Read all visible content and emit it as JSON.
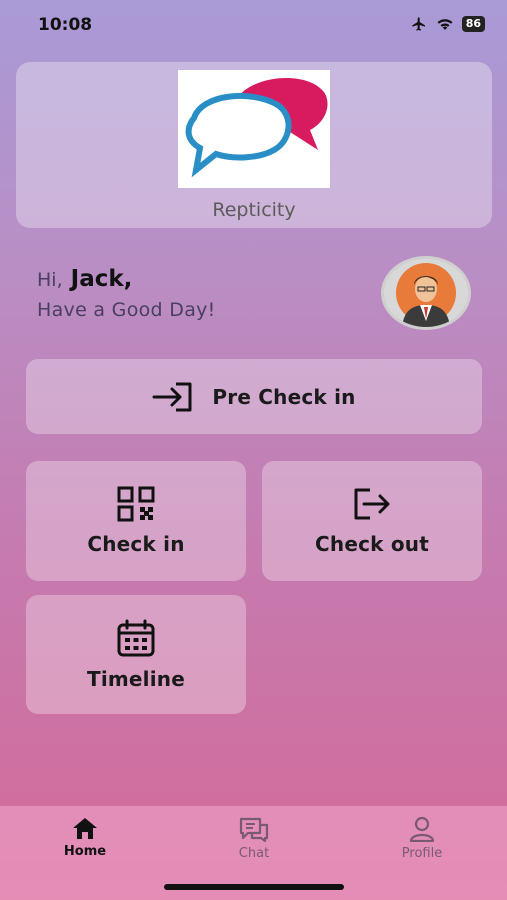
{
  "status_bar": {
    "time": "10:08",
    "battery": "86",
    "icons": [
      "airplane-icon",
      "wifi-icon",
      "battery-icon"
    ]
  },
  "brand": {
    "name": "Repticity"
  },
  "greeting": {
    "hi": "Hi,",
    "name": "Jack,",
    "message": "Have a Good Day!"
  },
  "actions": {
    "pre_check_in": "Pre Check in",
    "check_in": "Check in",
    "check_out": "Check out",
    "timeline": "Timeline"
  },
  "nav": {
    "home": "Home",
    "chat": "Chat",
    "profile": "Profile",
    "active": "home"
  },
  "colors": {
    "logo_blue": "#2a8ec6",
    "logo_pink": "#d81b5f",
    "bg_top": "#a99ad6",
    "bg_bottom": "#d46a98"
  }
}
